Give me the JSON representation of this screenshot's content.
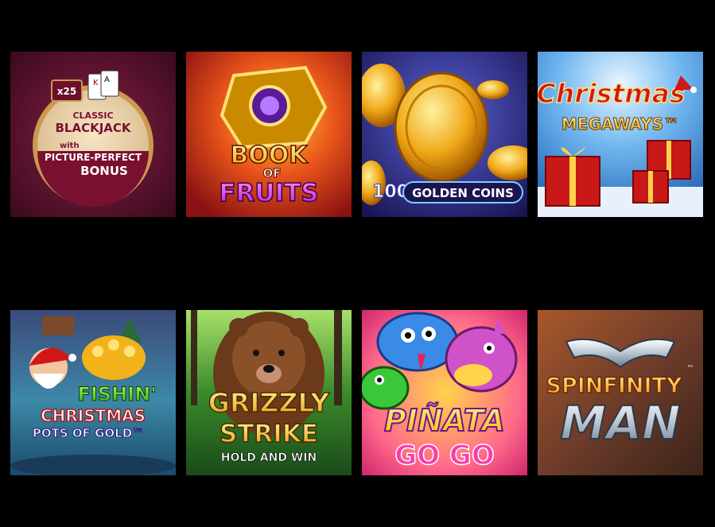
{
  "games": [
    {
      "name": "Classic Blackjack with Picture-Perfect Bonus",
      "badge": "x25",
      "line1": "CLASSIC",
      "line2": "BLACKJACK",
      "line3": "with",
      "line4": "PICTURE-PERFECT",
      "line5": "BONUS"
    },
    {
      "name": "Book of Fruits",
      "line1": "BOOK",
      "line2": "OF",
      "line3": "FRUITS"
    },
    {
      "name": "100 Golden Coins",
      "line1": "100",
      "line2": "GOLDEN COINS"
    },
    {
      "name": "Christmas Megaways",
      "line1": "Christmas",
      "line2": "MEGAWAYS™"
    },
    {
      "name": "Fishin' Christmas Pots of Gold",
      "line1": "FISHIN'",
      "line2": "CHRISTMAS",
      "line3": "POTS OF GOLD™"
    },
    {
      "name": "Grizzly Strike Hold and Win",
      "line1": "GRIZZLY",
      "line2": "STRIKE",
      "line3": "HOLD AND WIN"
    },
    {
      "name": "Piñata Go Go",
      "line1": "PIÑATA",
      "line2": "GO GO"
    },
    {
      "name": "Spinfinity Man",
      "line1": "SPINFINITY",
      "line2": "MAN",
      "tm": "™"
    }
  ]
}
